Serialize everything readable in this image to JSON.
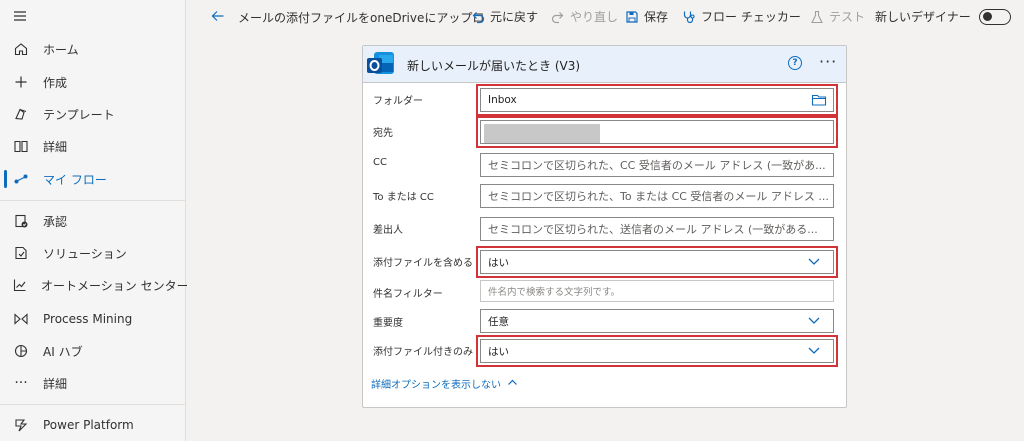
{
  "sidebar": {
    "items": [
      {
        "label": "ホーム"
      },
      {
        "label": "作成"
      },
      {
        "label": "テンプレート"
      },
      {
        "label": "詳細"
      },
      {
        "label": "マイ フロー"
      },
      {
        "label": "承認"
      },
      {
        "label": "ソリューション"
      },
      {
        "label": "オートメーション センター"
      },
      {
        "label": "Process Mining"
      },
      {
        "label": "AI ハブ"
      },
      {
        "label": "詳細"
      },
      {
        "label": "Power Platform"
      }
    ]
  },
  "toolbar": {
    "flow_name": "メールの添付ファイルをoneDriveにアップロ",
    "undo": "元に戻す",
    "redo": "やり直し",
    "save": "保存",
    "checker": "フロー チェッカー",
    "test": "テスト",
    "new_designer": "新しいデザイナー"
  },
  "card": {
    "title": "新しいメールが届いたとき (V3)",
    "fields": [
      {
        "label": "フォルダー",
        "value": "Inbox"
      },
      {
        "label": "宛先",
        "value": ""
      },
      {
        "label": "CC",
        "placeholder": "セミコロンで区切られた、CC 受信者のメール アドレス (一致があ..."
      },
      {
        "label": "To または CC",
        "placeholder": "セミコロンで区切られた、To または CC 受信者のメール アドレス ..."
      },
      {
        "label": "差出人",
        "placeholder": "セミコロンで区切られた、送信者のメール アドレス (一致がある..."
      },
      {
        "label": "添付ファイルを含める",
        "value": "はい"
      },
      {
        "label": "件名フィルター",
        "placeholder": "件名内で検索する文字列です。"
      },
      {
        "label": "重要度",
        "value": "任意"
      },
      {
        "label": "添付ファイル付きのみ",
        "value": "はい"
      }
    ],
    "advanced_link": "詳細オプションを表示しない"
  },
  "colors": {
    "accent": "#0f6cbd",
    "highlight": "#d13438",
    "header_bg": "#e8f1fb"
  }
}
